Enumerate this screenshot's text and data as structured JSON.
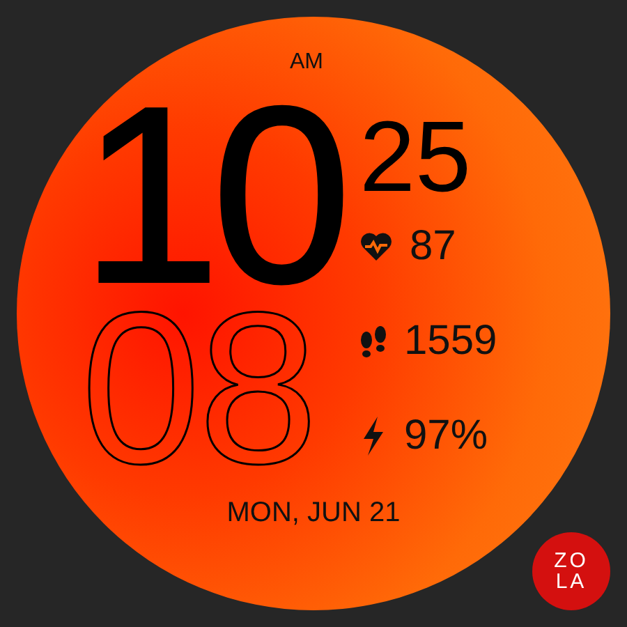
{
  "period": "AM",
  "hour": "10",
  "minute_outline": "08",
  "minute": "25",
  "stats": [
    {
      "kind": "heart",
      "value": "87"
    },
    {
      "kind": "steps",
      "value": "1559"
    },
    {
      "kind": "battery",
      "value": "97%"
    }
  ],
  "date": "MON, JUN 21",
  "logo": {
    "top": "ZO",
    "bottom": "LA"
  }
}
